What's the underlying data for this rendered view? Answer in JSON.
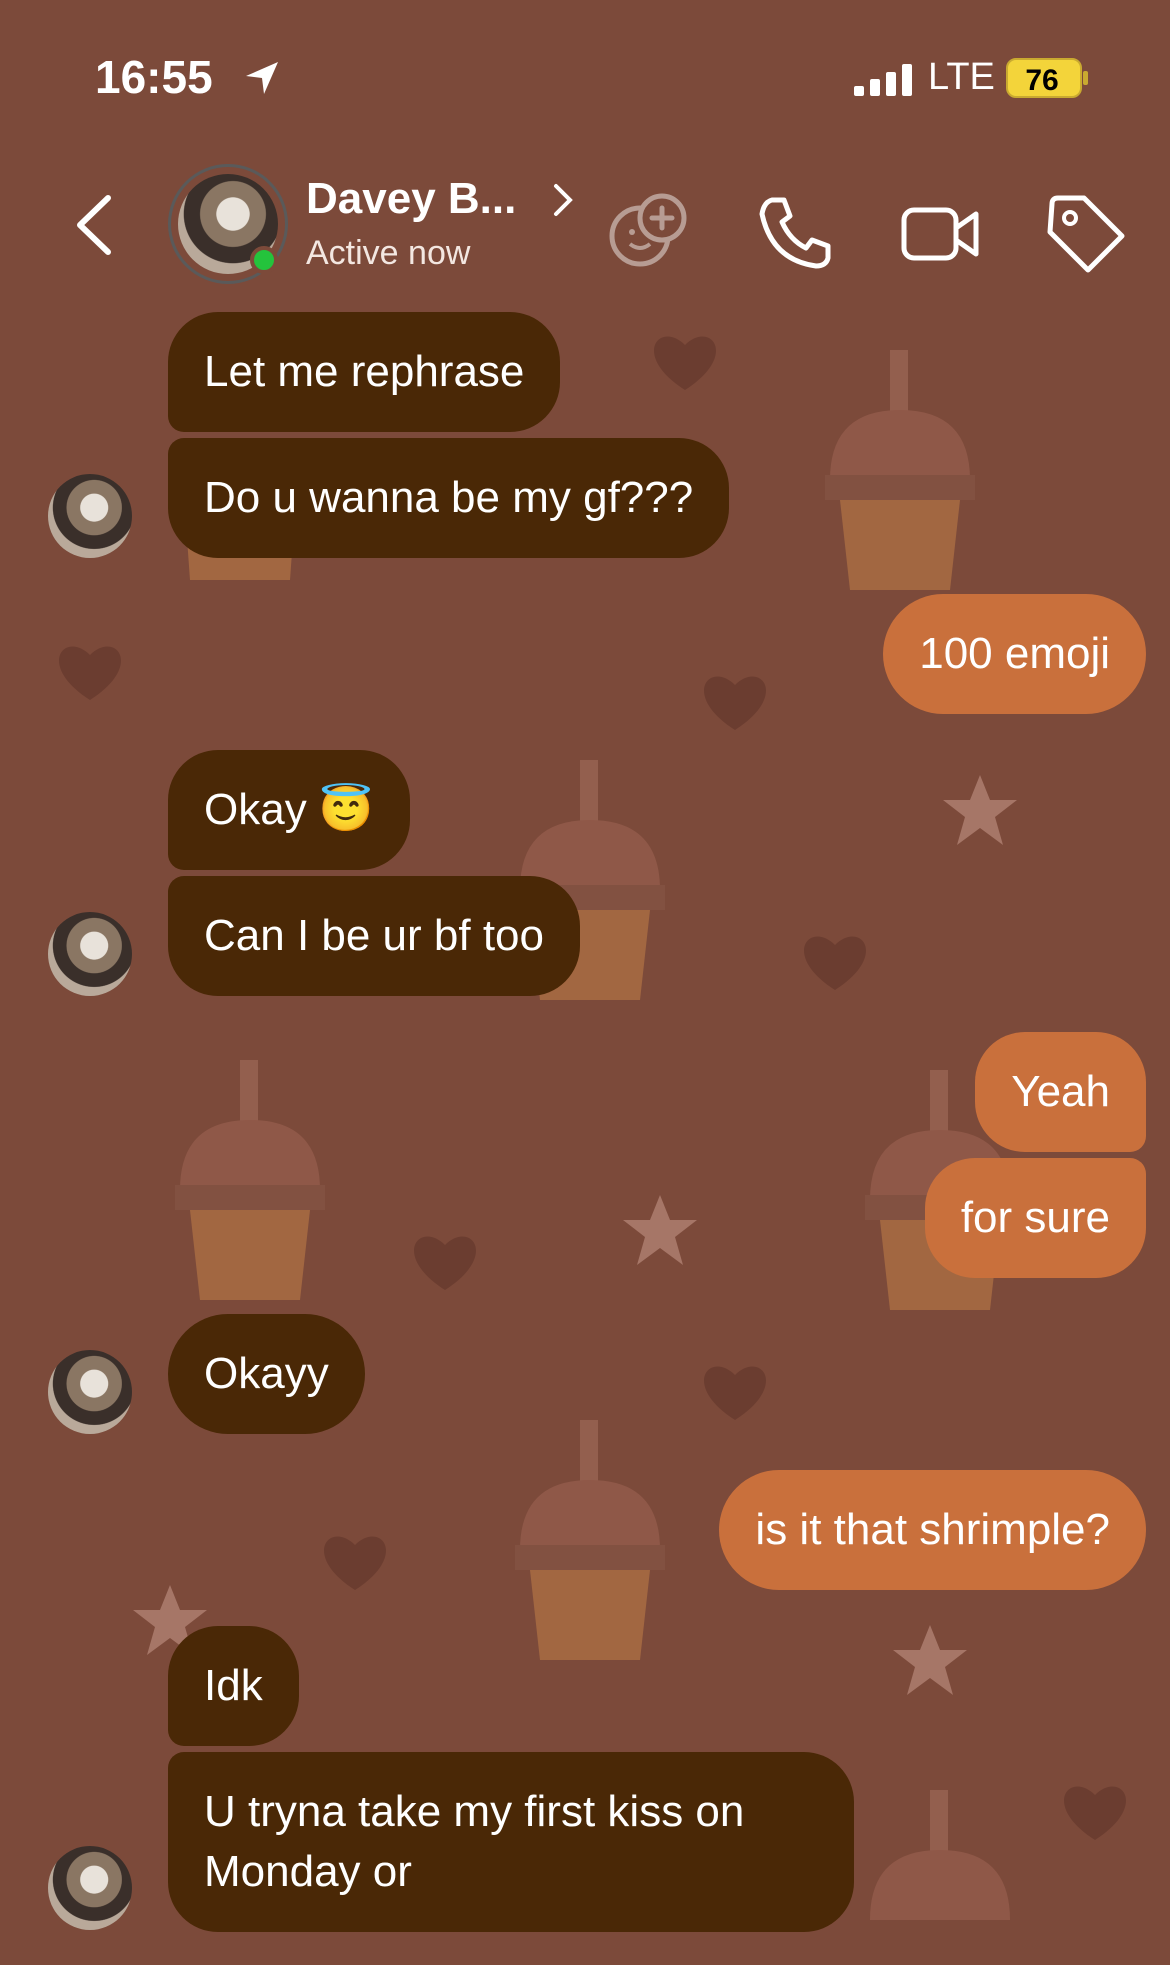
{
  "status_bar": {
    "time": "16:55",
    "network": "LTE",
    "battery": "76"
  },
  "header": {
    "name": "Davey B...",
    "status": "Active now"
  },
  "colors": {
    "background": "#7c4a3a",
    "incoming_bubble": "#4a2806",
    "outgoing_bubble": "#c9703c",
    "online": "#24c33c"
  },
  "messages": [
    {
      "from": "them",
      "text": "Let me rephrase"
    },
    {
      "from": "them",
      "text": "Do u wanna be my gf???"
    },
    {
      "from": "me",
      "text": "100 emoji"
    },
    {
      "from": "them",
      "text": "Okay 😇"
    },
    {
      "from": "them",
      "text": "Can I be ur bf too"
    },
    {
      "from": "me",
      "text": "Yeah"
    },
    {
      "from": "me",
      "text": "for sure"
    },
    {
      "from": "them",
      "text": "Okayy"
    },
    {
      "from": "me",
      "text": "is it that shrimple?"
    },
    {
      "from": "them",
      "text": "Idk"
    },
    {
      "from": "them",
      "text": "U tryna take my first kiss on Monday or"
    }
  ]
}
